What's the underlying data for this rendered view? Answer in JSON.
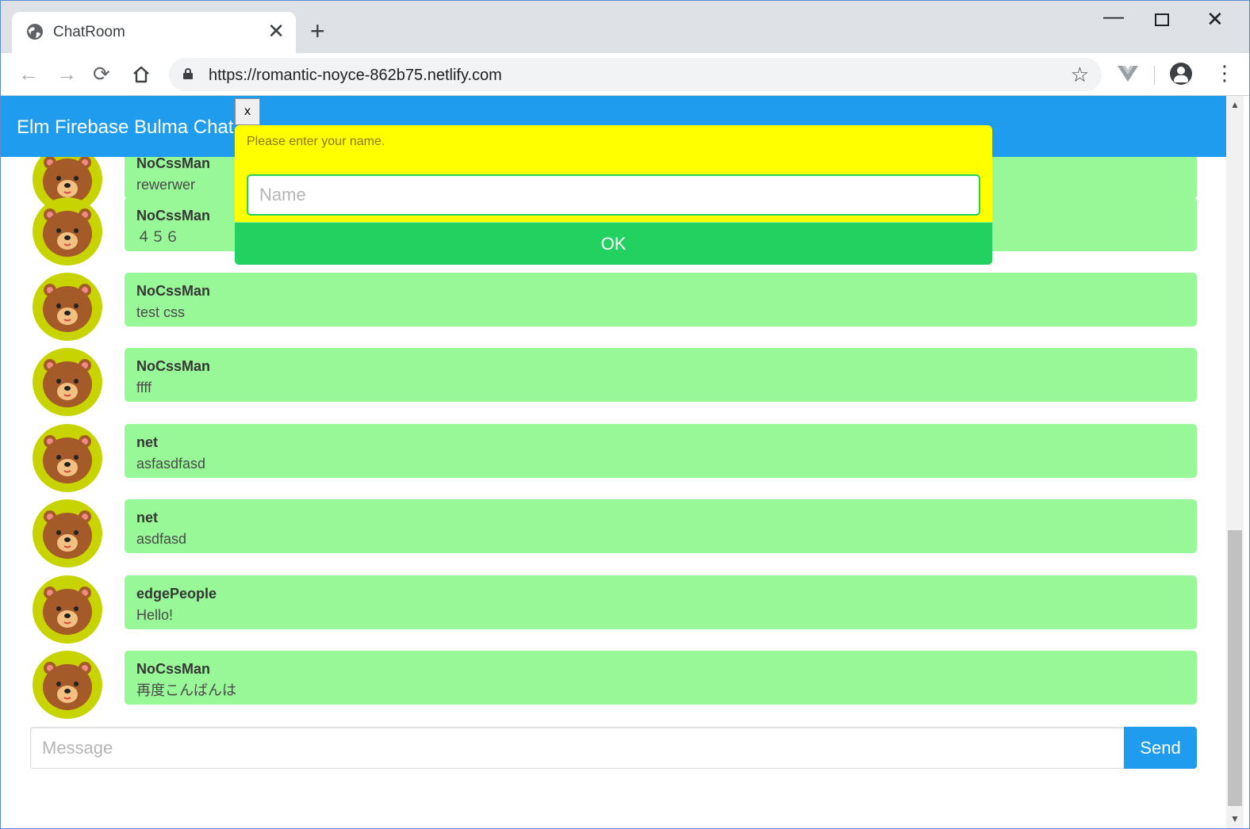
{
  "browser": {
    "tab_title": "ChatRoom",
    "tab_close": "✕",
    "new_tab": "+",
    "url": "https://romantic-noyce-862b75.netlify.com",
    "window_min": "—",
    "window_close": "✕"
  },
  "app": {
    "brand": "Elm Firebase Bulma Chat",
    "accent_color": "#209cee",
    "bubble_color": "#98f898",
    "avatar_color": "#c8d400"
  },
  "modal": {
    "close_label": "x",
    "prompt": "Please enter your name.",
    "name_placeholder": "Name",
    "ok_label": "OK",
    "background_color": "#ffff00",
    "ok_color": "#23d160"
  },
  "messages": [
    {
      "name": "NoCssMan",
      "text": "rewerwer"
    },
    {
      "name": "NoCssMan",
      "text": "４５６"
    },
    {
      "name": "NoCssMan",
      "text": "test css"
    },
    {
      "name": "NoCssMan",
      "text": "ffff"
    },
    {
      "name": "net",
      "text": "asfasdfasd"
    },
    {
      "name": "net",
      "text": "asdfasd"
    },
    {
      "name": "edgePeople",
      "text": "Hello!"
    },
    {
      "name": "NoCssMan",
      "text": "再度こんばんは"
    }
  ],
  "composer": {
    "placeholder": "Message",
    "send_label": "Send"
  }
}
